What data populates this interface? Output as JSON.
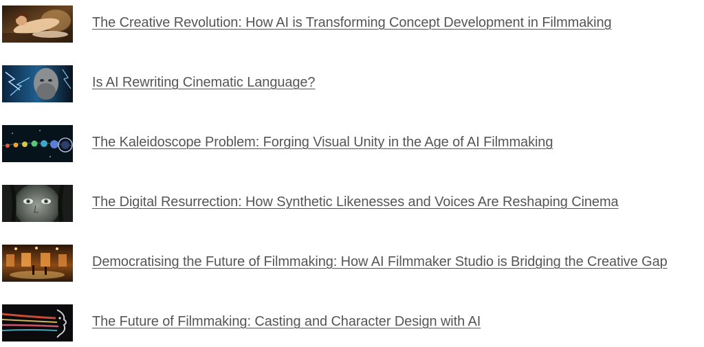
{
  "articles": [
    {
      "title": "The Creative Revolution: How AI is Transforming Concept Development in Filmmaking",
      "thumbnail": "classical-painting-reclining-figure-thumbnail"
    },
    {
      "title": "Is AI Rewriting Cinematic Language?",
      "thumbnail": "bearded-statue-blue-lightning-thumbnail"
    },
    {
      "title": "The Kaleidoscope Problem: Forging Visual Unity in the Age of AI Filmmaking",
      "thumbnail": "glowing-orbs-sequence-thumbnail"
    },
    {
      "title": "The Digital Resurrection: How Synthetic Likenesses and Voices Are Reshaping Cinema",
      "thumbnail": "close-up-face-eyes-thumbnail"
    },
    {
      "title": "Democratising the Future of Filmmaking: How AI Filmmaker Studio is Bridging the Creative Gap",
      "thumbnail": "warm-lit-film-set-thumbnail"
    },
    {
      "title": "The Future of Filmmaking: Casting and Character Design with AI",
      "thumbnail": "neon-light-streak-profile-thumbnail"
    }
  ]
}
